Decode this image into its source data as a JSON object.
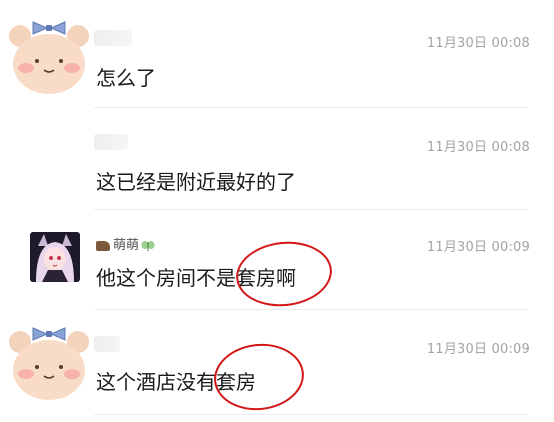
{
  "messages": [
    {
      "sender": "",
      "time": "11月30日 00:08",
      "content": "怎么了",
      "avatar": "bear-avatar"
    },
    {
      "sender": "",
      "time": "11月30日 00:08",
      "content": "这已经是附近最好的了",
      "avatar": "none"
    },
    {
      "sender": "萌萌",
      "time": "11月30日 00:09",
      "content": "他这个房间不是套房啊",
      "avatar": "anime-girl-avatar"
    },
    {
      "sender": "",
      "time": "11月30日 00:09",
      "content": "这个酒店没有套房",
      "avatar": "bear-avatar"
    }
  ],
  "colors": {
    "highlight_circle": "#d31616",
    "time_text": "#a3a3a3",
    "bear_face": "#f8dcc8",
    "bow": "#8aa3d6"
  },
  "annotations": [
    "circle around 套房啊",
    "circle around 有套房"
  ]
}
